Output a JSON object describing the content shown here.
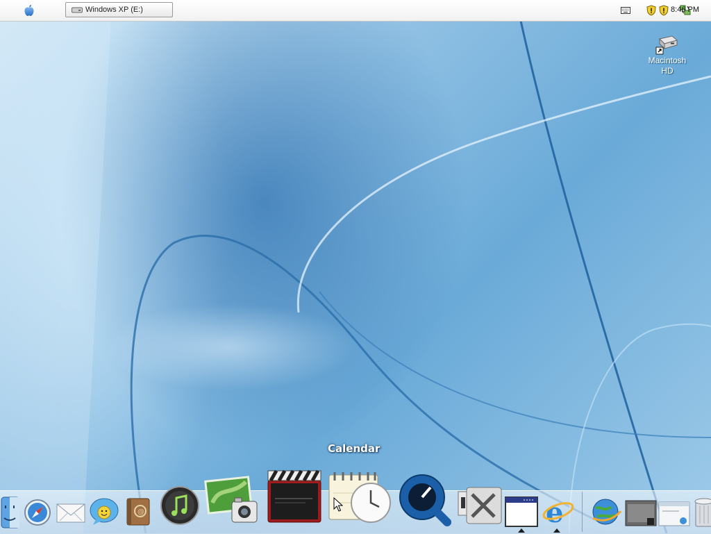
{
  "menubar": {
    "apple_menu_icon": "apple-logo-icon",
    "task_button": {
      "label": "Windows XP (E:)",
      "icon": "drive-icon"
    },
    "tray": {
      "icons": [
        "keyboard-icon",
        "security-shield-icon",
        "security-shield-icon",
        "network-icon"
      ],
      "clock": "8:46 PM"
    }
  },
  "desktop": {
    "icons": [
      {
        "label": "Macintosh HD",
        "icon": "hard-drive-icon"
      }
    ]
  },
  "dock": {
    "tooltip": "Calendar",
    "items": [
      "finder-icon",
      "safari-icon",
      "mail-icon",
      "ichat-icon",
      "address-book-icon",
      "itunes-icon",
      "iphoto-icon",
      "dvd-player-icon",
      "calendar-icon",
      "quicktime-icon",
      "system-preferences-icon",
      "window-icon",
      "internet-explorer-icon",
      "network-globe-icon",
      "window-thumbnail-icon",
      "window-thumbnail-icon",
      "trash-icon"
    ]
  },
  "colors": {
    "menubar": "#f5f5f5",
    "wallpaper_accent": "#6aaad8",
    "tooltip_text": "#ffffff"
  }
}
